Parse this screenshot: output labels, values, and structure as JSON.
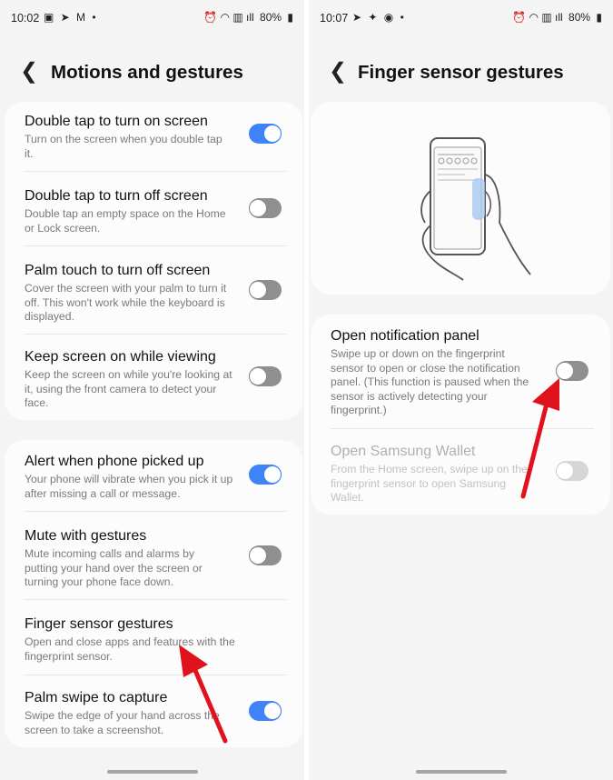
{
  "left": {
    "status": {
      "time": "10:02",
      "icons_left": "▣ ➤ M •",
      "icons_right": "⏰ ◠ ▥ ıll",
      "battery": "80%"
    },
    "title": "Motions and gestures",
    "items": [
      {
        "title": "Double tap to turn on screen",
        "desc": "Turn on the screen when you double tap it.",
        "toggle": "on"
      },
      {
        "title": "Double tap to turn off screen",
        "desc": "Double tap an empty space on the Home or Lock screen.",
        "toggle": "off"
      },
      {
        "title": "Palm touch to turn off screen",
        "desc": "Cover the screen with your palm to turn it off. This won't work while the keyboard is displayed.",
        "toggle": "off"
      },
      {
        "title": "Keep screen on while viewing",
        "desc": "Keep the screen on while you're looking at it, using the front camera to detect your face.",
        "toggle": "off"
      },
      {
        "title": "Alert when phone picked up",
        "desc": "Your phone will vibrate when you pick it up after missing a call or message.",
        "toggle": "on"
      },
      {
        "title": "Mute with gestures",
        "desc": "Mute incoming calls and alarms by putting your hand over the screen or turning your phone face down.",
        "toggle": "off"
      },
      {
        "title": "Finger sensor gestures",
        "desc": "Open and close apps and features with the fingerprint sensor.",
        "toggle": null
      },
      {
        "title": "Palm swipe to capture",
        "desc": "Swipe the edge of your hand across the screen to take a screenshot.",
        "toggle": "on"
      }
    ]
  },
  "right": {
    "status": {
      "time": "10:07",
      "icons_left": "➤ ✦ ◉ •",
      "icons_right": "⏰ ◠ ▥ ıll",
      "battery": "80%"
    },
    "title": "Finger sensor gestures",
    "items": [
      {
        "title": "Open notification panel",
        "desc": "Swipe up or down on the fingerprint sensor to open or close the notification panel. (This function is paused when the sensor is actively detecting your fingerprint.)",
        "toggle": "off"
      },
      {
        "title": "Open Samsung Wallet",
        "desc": "From the Home screen, swipe up on the fingerprint sensor to open Samsung Wallet.",
        "toggle": "disabled"
      }
    ]
  },
  "colors": {
    "toggle_on": "#3e83f8",
    "toggle_off": "#8f8f8f",
    "arrow": "#e0121e",
    "background": "#f4f4f4"
  },
  "icons": {
    "back": "chevron-left-icon",
    "annotation": "red-arrow-icon"
  }
}
